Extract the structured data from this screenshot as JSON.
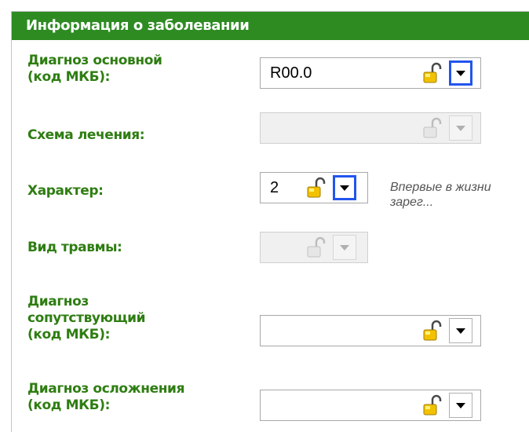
{
  "section": {
    "title": "Информация о заболевании"
  },
  "rows": {
    "main_diagnosis": {
      "label_line1": "Диагноз основной",
      "label_line2": "(код МКБ):",
      "value": "R00.0"
    },
    "treatment_scheme": {
      "label": "Схема лечения:",
      "value": ""
    },
    "character": {
      "label": "Характер:",
      "value": "2",
      "description": "Впервые в жизни зарег..."
    },
    "injury_type": {
      "label": "Вид травмы:",
      "value": ""
    },
    "concomitant_diagnosis": {
      "label_line1": "Диагноз",
      "label_line2": "сопутствующий",
      "label_line3": "(код МКБ):",
      "value": ""
    },
    "complication_diagnosis": {
      "label_line1": "Диагноз осложнения",
      "label_line2": "(код МКБ):",
      "value": ""
    }
  },
  "icons": {
    "lock": "padlock-open-icon",
    "dropdown": "chevron-down-icon"
  },
  "colors": {
    "header_bg": "#2e8b22",
    "label_text": "#2e7d12",
    "focus_border": "#2255ee",
    "lock_gold": "#f2c200"
  }
}
